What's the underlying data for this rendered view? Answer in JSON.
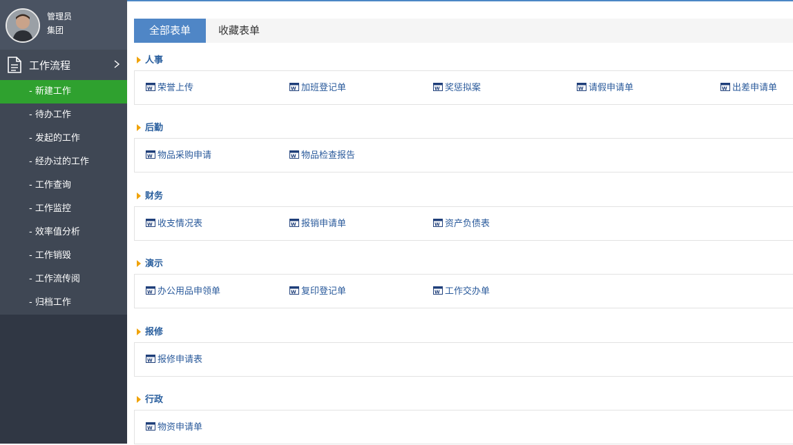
{
  "user": {
    "name": "管理员",
    "org": "集团"
  },
  "sidebar": {
    "section_title": "工作流程",
    "items": [
      {
        "label": "- 新建工作",
        "active": true
      },
      {
        "label": "- 待办工作"
      },
      {
        "label": "- 发起的工作"
      },
      {
        "label": "- 经办过的工作"
      },
      {
        "label": "- 工作查询"
      },
      {
        "label": "- 工作监控"
      },
      {
        "label": "- 效率值分析"
      },
      {
        "label": "- 工作销毁"
      },
      {
        "label": "- 工作流传阅"
      },
      {
        "label": "- 归档工作"
      }
    ]
  },
  "tabs": {
    "all": "全部表单",
    "favorites": "收藏表单"
  },
  "categories": [
    {
      "name": "人事",
      "forms": [
        "荣誉上传",
        "加班登记单",
        "奖惩拟案",
        "请假申请单",
        "出差申请单"
      ]
    },
    {
      "name": "后勤",
      "forms": [
        "物品采购申请",
        "物品检查报告"
      ]
    },
    {
      "name": "财务",
      "forms": [
        "收支情况表",
        "报销申请单",
        "资产负债表"
      ]
    },
    {
      "name": "演示",
      "forms": [
        "办公用品申领单",
        "复印登记单",
        "工作交办单"
      ]
    },
    {
      "name": "报修",
      "forms": [
        "报修申请表"
      ]
    },
    {
      "name": "行政",
      "forms": [
        "物资申请单"
      ]
    }
  ],
  "colors": {
    "accent": "#4f86c6",
    "active_menu": "#2fa12f",
    "link": "#2a5a9b",
    "category": "#2a5f9e"
  }
}
